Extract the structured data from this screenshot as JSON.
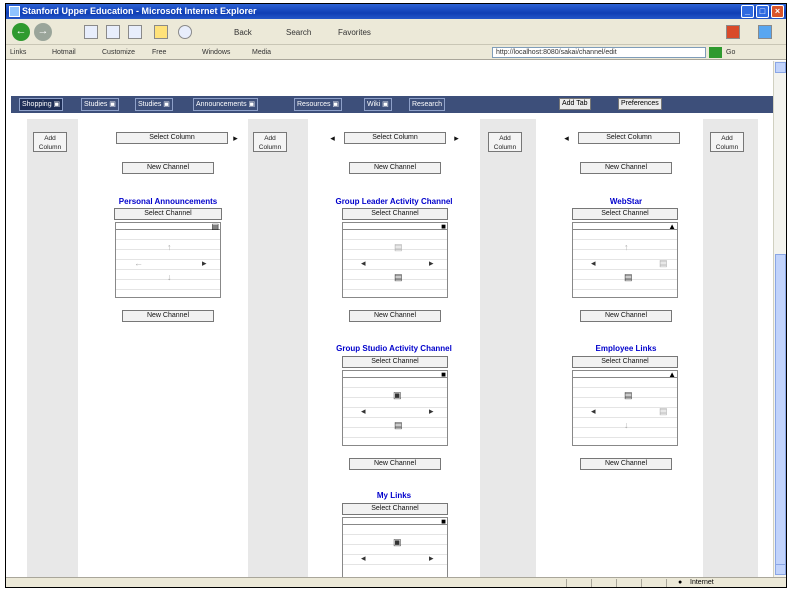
{
  "window": {
    "title": "Stanford Upper Education - Microsoft Internet Explorer",
    "minimize": "_",
    "maximize": "□",
    "close": "×"
  },
  "toolbar": {
    "back": "←",
    "forward": "→",
    "items": [
      "Back",
      "Search",
      "Favorites"
    ]
  },
  "links": {
    "label": "Links",
    "items": [
      "Links",
      "Hotmail",
      "Customize",
      "Free",
      "Windows",
      "Media",
      "Go"
    ],
    "address": "http://localhost:8080/sakai/channel/edit"
  },
  "tabs": [
    {
      "label": "Shopping ▣",
      "active": true
    },
    {
      "label": "Studies ▣",
      "active": false
    },
    {
      "label": "Studies ▣",
      "active": false
    },
    {
      "label": "Announcements ▣",
      "active": false
    },
    {
      "label": "Resources ▣",
      "active": false
    },
    {
      "label": "Wiki ▣",
      "active": false
    },
    {
      "label": "Research",
      "active": false
    }
  ],
  "tab_buttons": [
    "Add Tab",
    "Preferences"
  ],
  "column_controls": {
    "add_column": "Add\nColumn",
    "select_column": "Select Column",
    "new_channel": "New Channel",
    "select_channel": "Select Channel",
    "arrow_left": "◂",
    "arrow_right": "▸"
  },
  "columns": [
    {
      "channels": [
        {
          "title": "Personal Announcements"
        }
      ]
    },
    {
      "channels": [
        {
          "title": "Group Leader Activity Channel"
        },
        {
          "title": "Group Studio Activity Channel"
        },
        {
          "title": "My Links"
        }
      ]
    },
    {
      "channels": [
        {
          "title": "WebStar"
        },
        {
          "title": "Employee Links"
        }
      ]
    }
  ],
  "status": {
    "text": "",
    "zone": "Internet"
  }
}
